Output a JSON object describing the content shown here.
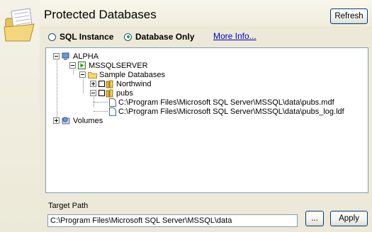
{
  "header": {
    "title": "Protected Databases",
    "refresh_label": "Refresh"
  },
  "mode": {
    "options": [
      {
        "label": "SQL Instance",
        "selected": false
      },
      {
        "label": "Database Only",
        "selected": true
      }
    ],
    "more_info_label": "More Info..."
  },
  "tree": {
    "root_label": "ALPHA",
    "instance_label": "MSSQLSERVER",
    "group_label": "Sample Databases",
    "db1_label": "Northwind",
    "db2_label": "pubs",
    "file1_label": "C:\\Program Files\\Microsoft SQL Server\\MSSQL\\data\\pubs.mdf",
    "file2_label": "C:\\Program Files\\Microsoft SQL Server\\MSSQL\\data\\pubs_log.ldf",
    "volumes_label": "Volumes"
  },
  "target": {
    "label": "Target Path",
    "value": "C:\\Program Files\\Microsoft SQL Server\\MSSQL\\data",
    "browse_label": "...",
    "apply_label": "Apply"
  },
  "icons": [
    "open-folder-icon",
    "computer-icon",
    "server-running-icon",
    "folder-icon",
    "database-icon",
    "file-icon",
    "volumes-icon"
  ],
  "colors": {
    "background": "#ece9d8",
    "link": "#0000cc",
    "running": "#21a121"
  }
}
